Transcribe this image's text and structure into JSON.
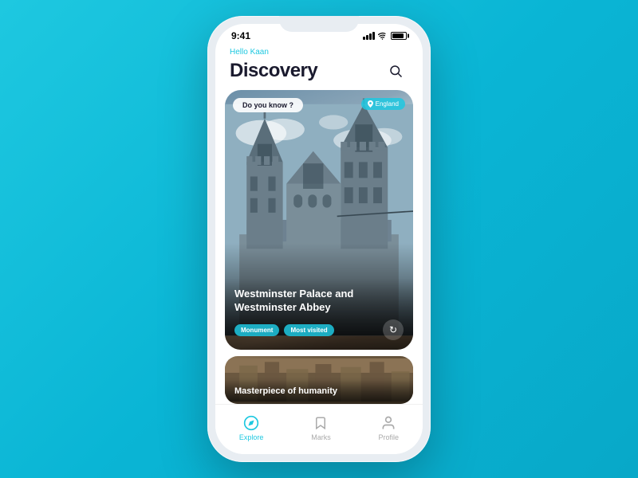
{
  "status": {
    "time": "9:41"
  },
  "header": {
    "greeting": "Hello Kaan",
    "title": "Discovery"
  },
  "feature_card": {
    "badge": "Do you know ?",
    "location": "England",
    "title": "Westminster Palace and Westminster Abbey",
    "tags": [
      "Monument",
      "Most visited"
    ]
  },
  "secondary_card": {
    "title": "Masterpiece of humanity"
  },
  "nav": {
    "items": [
      {
        "label": "Explore",
        "active": true
      },
      {
        "label": "Marks",
        "active": false
      },
      {
        "label": "Profile",
        "active": false
      }
    ]
  }
}
